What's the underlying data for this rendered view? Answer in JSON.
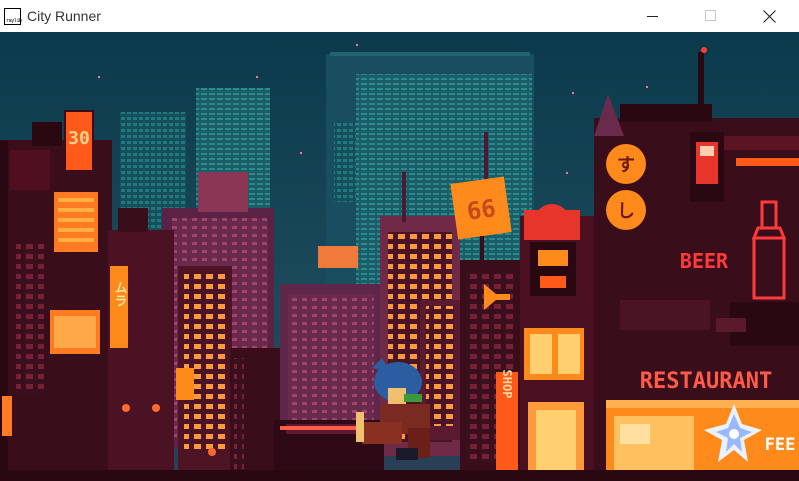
{
  "window": {
    "title": "City Runner",
    "icon": "raylib-icon",
    "icon_text": "raylib",
    "controls": {
      "minimize": "minimize-icon",
      "maximize": "maximize-icon",
      "close": "close-icon"
    }
  },
  "scene": {
    "signs": {
      "tower_sign": "30",
      "billboard": "66",
      "vertical_left": "ムラ",
      "lantern_top": "す",
      "lantern_bottom": "し",
      "beer": "BEER",
      "shop": "SHOP",
      "restaurant": "RESTAURANT",
      "feed": "FEE"
    }
  },
  "colors": {
    "sky_top": "#0c3c4e",
    "sky_bottom": "#1d4d5e",
    "neon_orange": "#ff8a1c",
    "neon_red": "#e8352b",
    "building_dark": "#3a0d1a",
    "building_purple": "#6b2a4c"
  }
}
